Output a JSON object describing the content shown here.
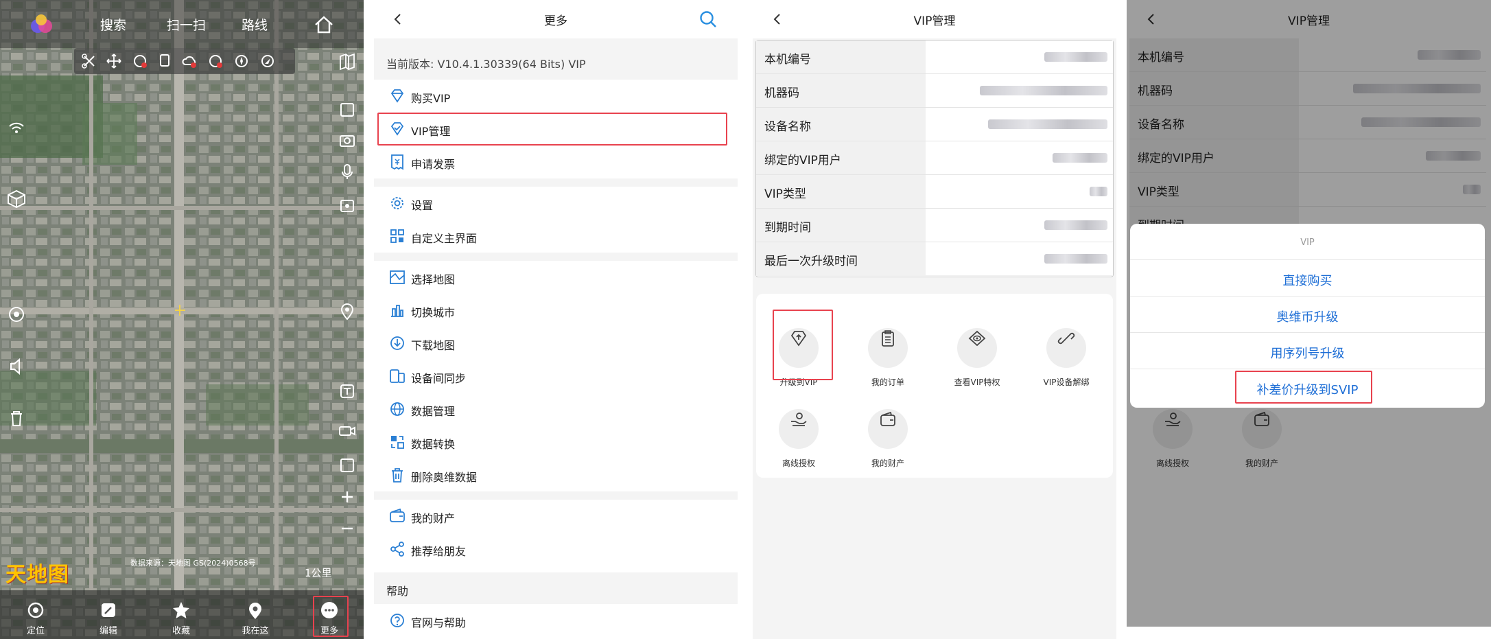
{
  "map_screen": {
    "top_tabs": [
      "搜索",
      "扫一扫",
      "路线"
    ],
    "watermark_logo": "天地图",
    "map_credit": "数据来源：天地图 GS(2024)0568号",
    "scale": "1公里",
    "bottom_nav": [
      "定位",
      "编辑",
      "收藏",
      "我在这",
      "更多"
    ]
  },
  "more_screen": {
    "title": "更多",
    "version": "当前版本: V10.4.1.30339(64 Bits) VIP",
    "items": [
      "购买VIP",
      "VIP管理",
      "申请发票",
      "设置",
      "自定义主界面",
      "选择地图",
      "切换城市",
      "下载地图",
      "设备间同步",
      "数据管理",
      "数据转换",
      "删除奥维数据",
      "我的财产",
      "推荐给朋友"
    ],
    "help_section": "帮助",
    "help_item": "官网与帮助"
  },
  "vip_screen": {
    "title": "VIP管理",
    "fields": [
      "本机编号",
      "机器码",
      "设备名称",
      "绑定的VIP用户",
      "VIP类型",
      "到期时间",
      "最后一次升级时间"
    ],
    "actions": [
      "升级到VIP",
      "我的订单",
      "查看VIP特权",
      "VIP设备解绑",
      "离线授权",
      "我的财产"
    ]
  },
  "vip_dialog_screen": {
    "title": "VIP管理",
    "fields": [
      "本机编号",
      "机器码",
      "设备名称",
      "绑定的VIP用户",
      "VIP类型",
      "到期时间"
    ],
    "sheet_title": "VIP",
    "options": [
      "直接购买",
      "奥维币升级",
      "用序列号升级",
      "补差价升级到SVIP"
    ],
    "bg_actions": [
      "离线授权",
      "我的财产"
    ]
  },
  "colors": {
    "highlight": "#e8424e",
    "link_blue": "#1f6fd6",
    "icon_blue": "#2a7fd4"
  }
}
